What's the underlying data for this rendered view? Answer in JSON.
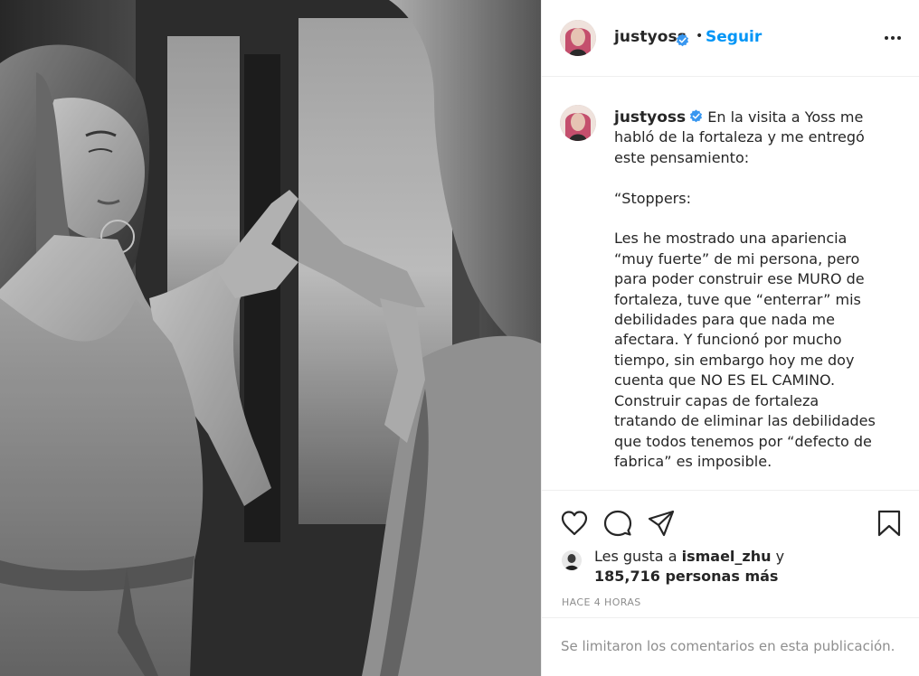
{
  "header": {
    "username": "justyoss",
    "separator": "•",
    "follow_label": "Seguir",
    "avatar_icon": "profile-avatar",
    "verified_icon": "verified-badge-icon",
    "more_icon": "more-options-icon"
  },
  "caption": {
    "username": "justyoss",
    "text": " En la visita a Yoss me habló de la fortaleza y me entregó este pensamiento:\n\n“Stoppers:\n\nLes he mostrado una apariencia “muy fuerte” de mi persona, pero para poder construir ese MURO de fortaleza, tuve que “enterrar” mis debilidades para que nada me afectara. Y funcionó por mucho tiempo, sin embargo hoy me doy cuenta que NO ES EL CAMINO. Construir capas de fortaleza tratando de eliminar las debilidades que todos tenemos por “defecto de fabrica” es imposible.\n\nTodos tenemos diferentes debilidades"
  },
  "actions": {
    "like_icon": "heart-icon",
    "comment_icon": "comment-icon",
    "share_icon": "send-icon",
    "save_icon": "bookmark-icon"
  },
  "likes": {
    "prefix": "Les gusta a",
    "liker": "ismael_zhu",
    "conjunction": "y",
    "count_text": "185,716 personas más"
  },
  "timestamp": "HACE 4 HORAS",
  "footer": {
    "comments_limited": "Se limitaron los comentarios en esta publicación."
  },
  "colors": {
    "accent": "#0095f6",
    "verified": "#3897f0",
    "muted": "#8e8e8e",
    "text": "#262626",
    "border": "#efefef"
  }
}
